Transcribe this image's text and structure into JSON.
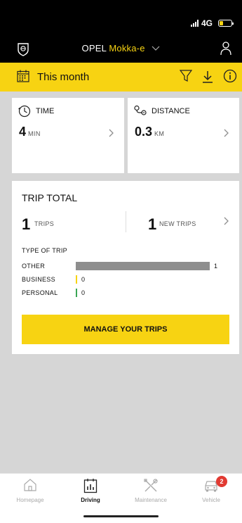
{
  "status_bar": {
    "network": "4G"
  },
  "header": {
    "brand": "OPEL",
    "model": "Mokka-e"
  },
  "filter": {
    "period": "This month"
  },
  "stats": {
    "time": {
      "label": "TIME",
      "value": "4",
      "unit": "MIN"
    },
    "distance": {
      "label": "DISTANCE",
      "value": "0.3",
      "unit": "KM"
    }
  },
  "trip_total": {
    "title": "TRIP TOTAL",
    "trips_count": "1",
    "trips_label": "TRIPS",
    "new_trips_count": "1",
    "new_trips_label": "NEW TRIPS",
    "type_title": "TYPE OF TRIP",
    "types": [
      {
        "label": "OTHER",
        "value": 1,
        "display": "1",
        "color": "#8e8e8e"
      },
      {
        "label": "BUSINESS",
        "value": 0,
        "display": "0",
        "color": "#f7d312"
      },
      {
        "label": "PERSONAL",
        "value": 0,
        "display": "0",
        "color": "#3aa655"
      }
    ],
    "manage_button": "MANAGE YOUR TRIPS"
  },
  "tabs": [
    {
      "label": "Homepage",
      "icon": "home-icon",
      "active": false
    },
    {
      "label": "Driving",
      "icon": "driving-chart-icon",
      "active": true
    },
    {
      "label": "Maintenance",
      "icon": "tools-icon",
      "active": false
    },
    {
      "label": "Vehicle",
      "icon": "car-icon",
      "active": false,
      "badge": "2"
    }
  ],
  "colors": {
    "accent": "#f7d312",
    "header_bg": "#000000",
    "badge": "#e13a32"
  }
}
